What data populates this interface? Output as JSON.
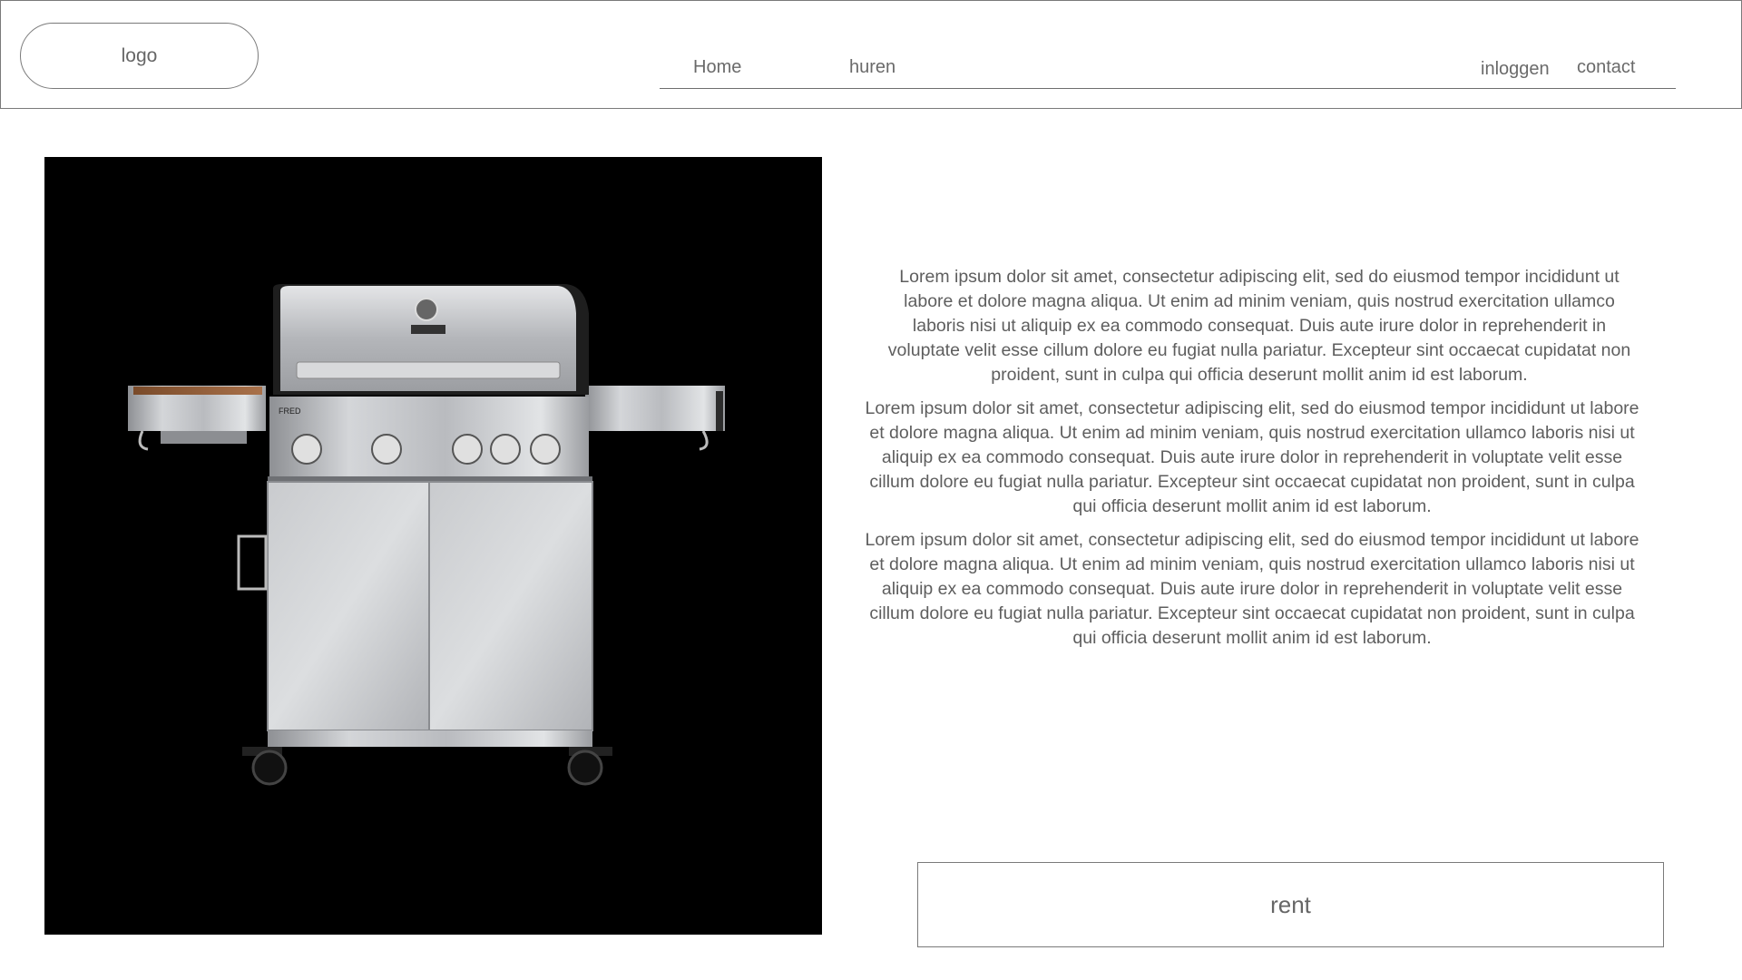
{
  "header": {
    "logo_text": "logo",
    "nav": {
      "home": "Home",
      "huren": "huren",
      "inloggen": "inloggen",
      "contact": "contact"
    }
  },
  "product": {
    "image_icon": "gas-grill-photo",
    "brand_label": "FRED"
  },
  "description": {
    "paragraphs": [
      "Lorem ipsum dolor sit amet, consectetur adipiscing elit, sed do eiusmod tempor incididunt ut labore et dolore magna aliqua. Ut enim ad minim veniam, quis nostrud exercitation ullamco laboris nisi ut aliquip ex ea commodo consequat. Duis aute irure dolor in reprehenderit in voluptate velit esse cillum dolore eu fugiat nulla pariatur. Excepteur sint occaecat cupidatat non proident, sunt in culpa qui officia deserunt mollit anim id est laborum.",
      "Lorem ipsum dolor sit amet, consectetur adipiscing elit, sed do eiusmod tempor incididunt ut labore et dolore magna aliqua. Ut enim ad minim veniam, quis nostrud exercitation ullamco laboris nisi ut aliquip ex ea commodo consequat. Duis aute irure dolor in reprehenderit in voluptate velit esse cillum dolore eu fugiat nulla pariatur. Excepteur sint occaecat cupidatat non proident, sunt in culpa qui officia deserunt mollit anim id est laborum.",
      "Lorem ipsum dolor sit amet, consectetur adipiscing elit, sed do eiusmod tempor incididunt ut labore et dolore magna aliqua. Ut enim ad minim veniam, quis nostrud exercitation ullamco laboris nisi ut aliquip ex ea commodo consequat. Duis aute irure dolor in reprehenderit in voluptate velit esse cillum dolore eu fugiat nulla pariatur. Excepteur sint occaecat cupidatat non proident, sunt in culpa qui officia deserunt mollit anim id est laborum."
    ]
  },
  "actions": {
    "rent_label": "rent"
  }
}
